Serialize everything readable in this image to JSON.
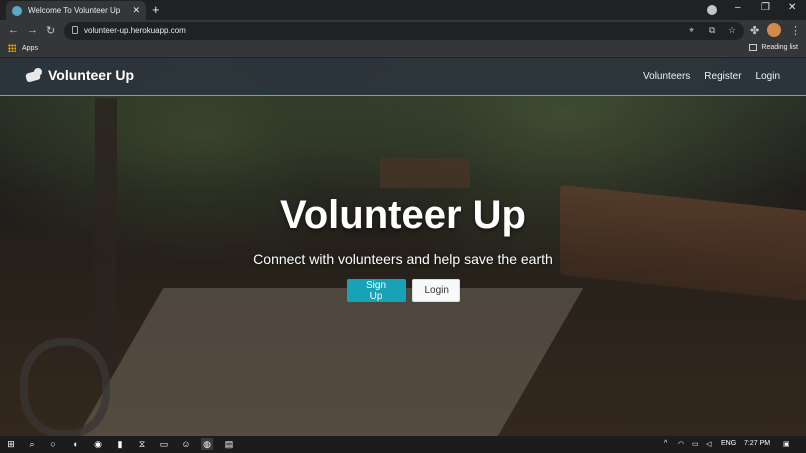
{
  "browser": {
    "tab_title": "Welcome To Volunteer Up",
    "url": "volunteer-up.herokuapp.com",
    "bookmarks": {
      "apps": "Apps",
      "reading_list": "Reading list"
    }
  },
  "site": {
    "brand": "Volunteer Up",
    "nav": [
      "Volunteers",
      "Register",
      "Login"
    ],
    "hero": {
      "title": "Volunteer Up",
      "subtitle": "Connect with volunteers and help save the earth",
      "primary_button": "Sign Up",
      "secondary_button": "Login"
    },
    "colors": {
      "accent": "#17a2b8",
      "navbar": "#2b343c"
    }
  },
  "taskbar": {
    "language": "ENG",
    "time": "7:27 PM"
  }
}
